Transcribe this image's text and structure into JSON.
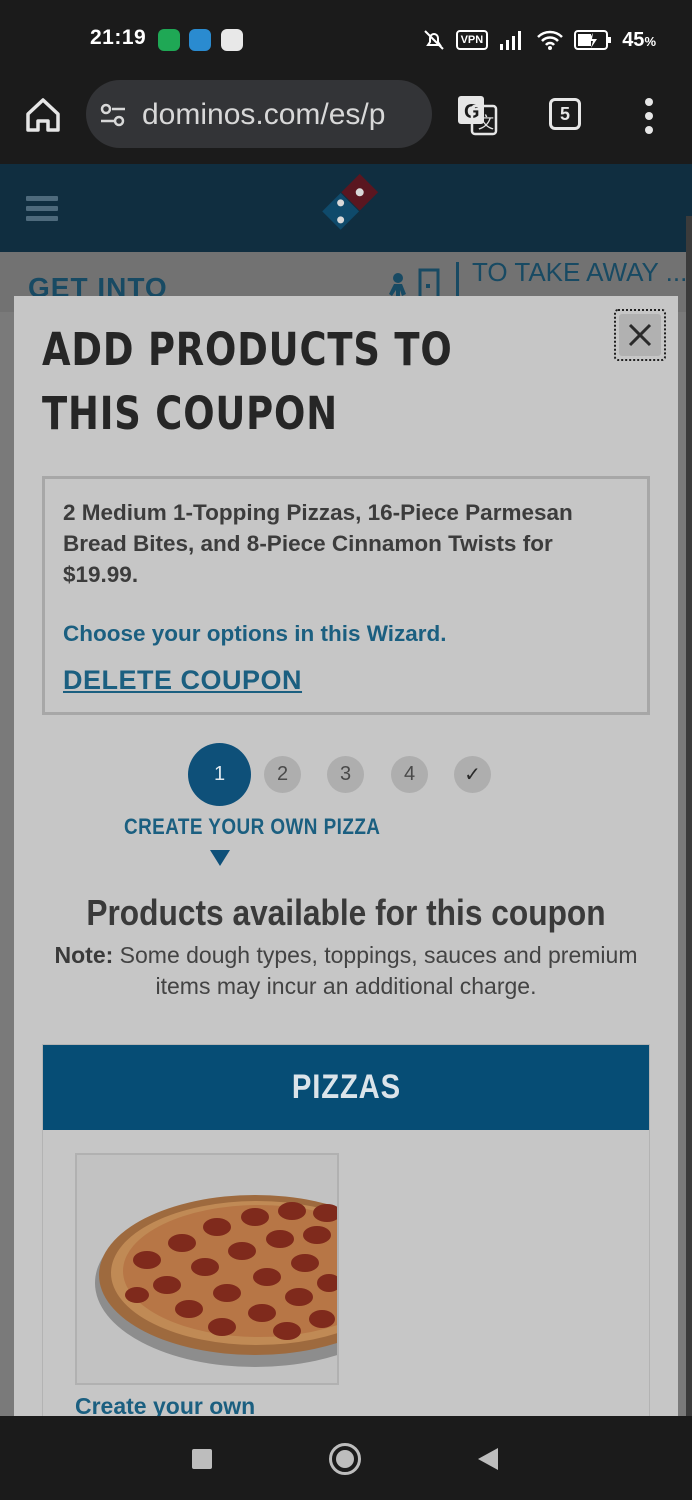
{
  "status_bar": {
    "time": "21:19",
    "vpn": "VPN",
    "battery_percent": "45",
    "battery_unit": "%"
  },
  "browser": {
    "url": "dominos.com/es/p",
    "tab_count": "5"
  },
  "site": {
    "subnav_left": "GET INTO",
    "subnav_right": "TO TAKE AWAY ..."
  },
  "modal": {
    "title": "ADD PRODUCTS TO THIS COUPON",
    "coupon": {
      "description": "2 Medium 1-Topping Pizzas, 16-Piece Parmesan Bread Bites, and 8-Piece Cinnamon Twists for $19.99.",
      "wizard_text": "Choose your options in this Wizard.",
      "delete_label": "DELETE COUPON"
    },
    "steps": [
      "1",
      "2",
      "3",
      "4",
      "✓"
    ],
    "active_step": 1,
    "active_step_label": "CREATE YOUR OWN PIZZA",
    "products_heading": "Products available for this coupon",
    "note_label": "Note:",
    "note_text": " Some dough types, toppings, sauces and premium items may incur an additional charge.",
    "section_title": "PIZZAS",
    "products": [
      {
        "name": "Create your own"
      }
    ]
  },
  "colors": {
    "accent": "#0e5079",
    "link": "#1b5f80",
    "header_bar": "#064d75"
  }
}
